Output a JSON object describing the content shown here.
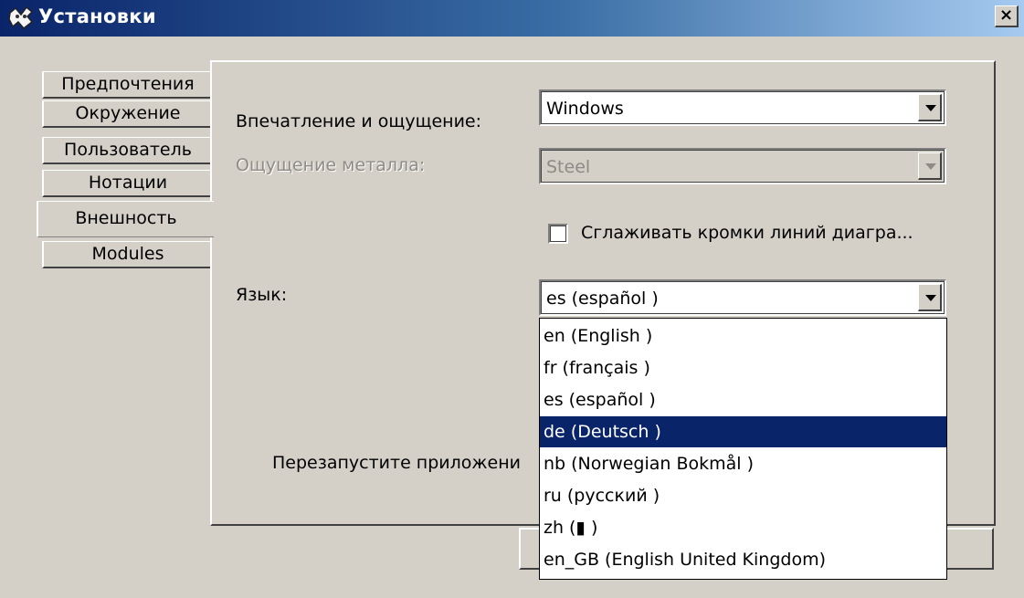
{
  "window": {
    "title": "Установки",
    "close_glyph": "×",
    "icon": "app-logo-icon"
  },
  "tabs": [
    {
      "label": "Предпочтения",
      "active": false
    },
    {
      "label": "Окружение",
      "active": false
    },
    {
      "label": "Пользователь",
      "active": false
    },
    {
      "label": "Нотации",
      "active": false
    },
    {
      "label": "Внешность",
      "active": true
    },
    {
      "label": "Modules",
      "active": false
    }
  ],
  "appearance": {
    "look_and_feel_label": "Впечатление и ощущение:",
    "look_and_feel_value": "Windows",
    "metal_theme_label": "Ощущение металла:",
    "metal_theme_value": "Steel",
    "metal_theme_enabled": false,
    "antialias_label": "Сглаживать кромки линий диагра...",
    "antialias_checked": false,
    "language_label": "Язык:",
    "language_value": "es (español )",
    "restart_note": "Перезапустите приложени"
  },
  "language_dropdown": {
    "open": true,
    "options": [
      "en (English )",
      "fr (français )",
      "es (español )",
      "de (Deutsch )",
      "nb (Norwegian Bokmål )",
      "ru (русский )",
      "zh (▮ )",
      "en_GB (English United Kingdom)"
    ],
    "highlighted": "de (Deutsch )"
  },
  "colors": {
    "window_bg": "#d4d0c8",
    "title_start": "#0a246a",
    "title_end": "#a6caf0",
    "highlight": "#0a246a"
  }
}
